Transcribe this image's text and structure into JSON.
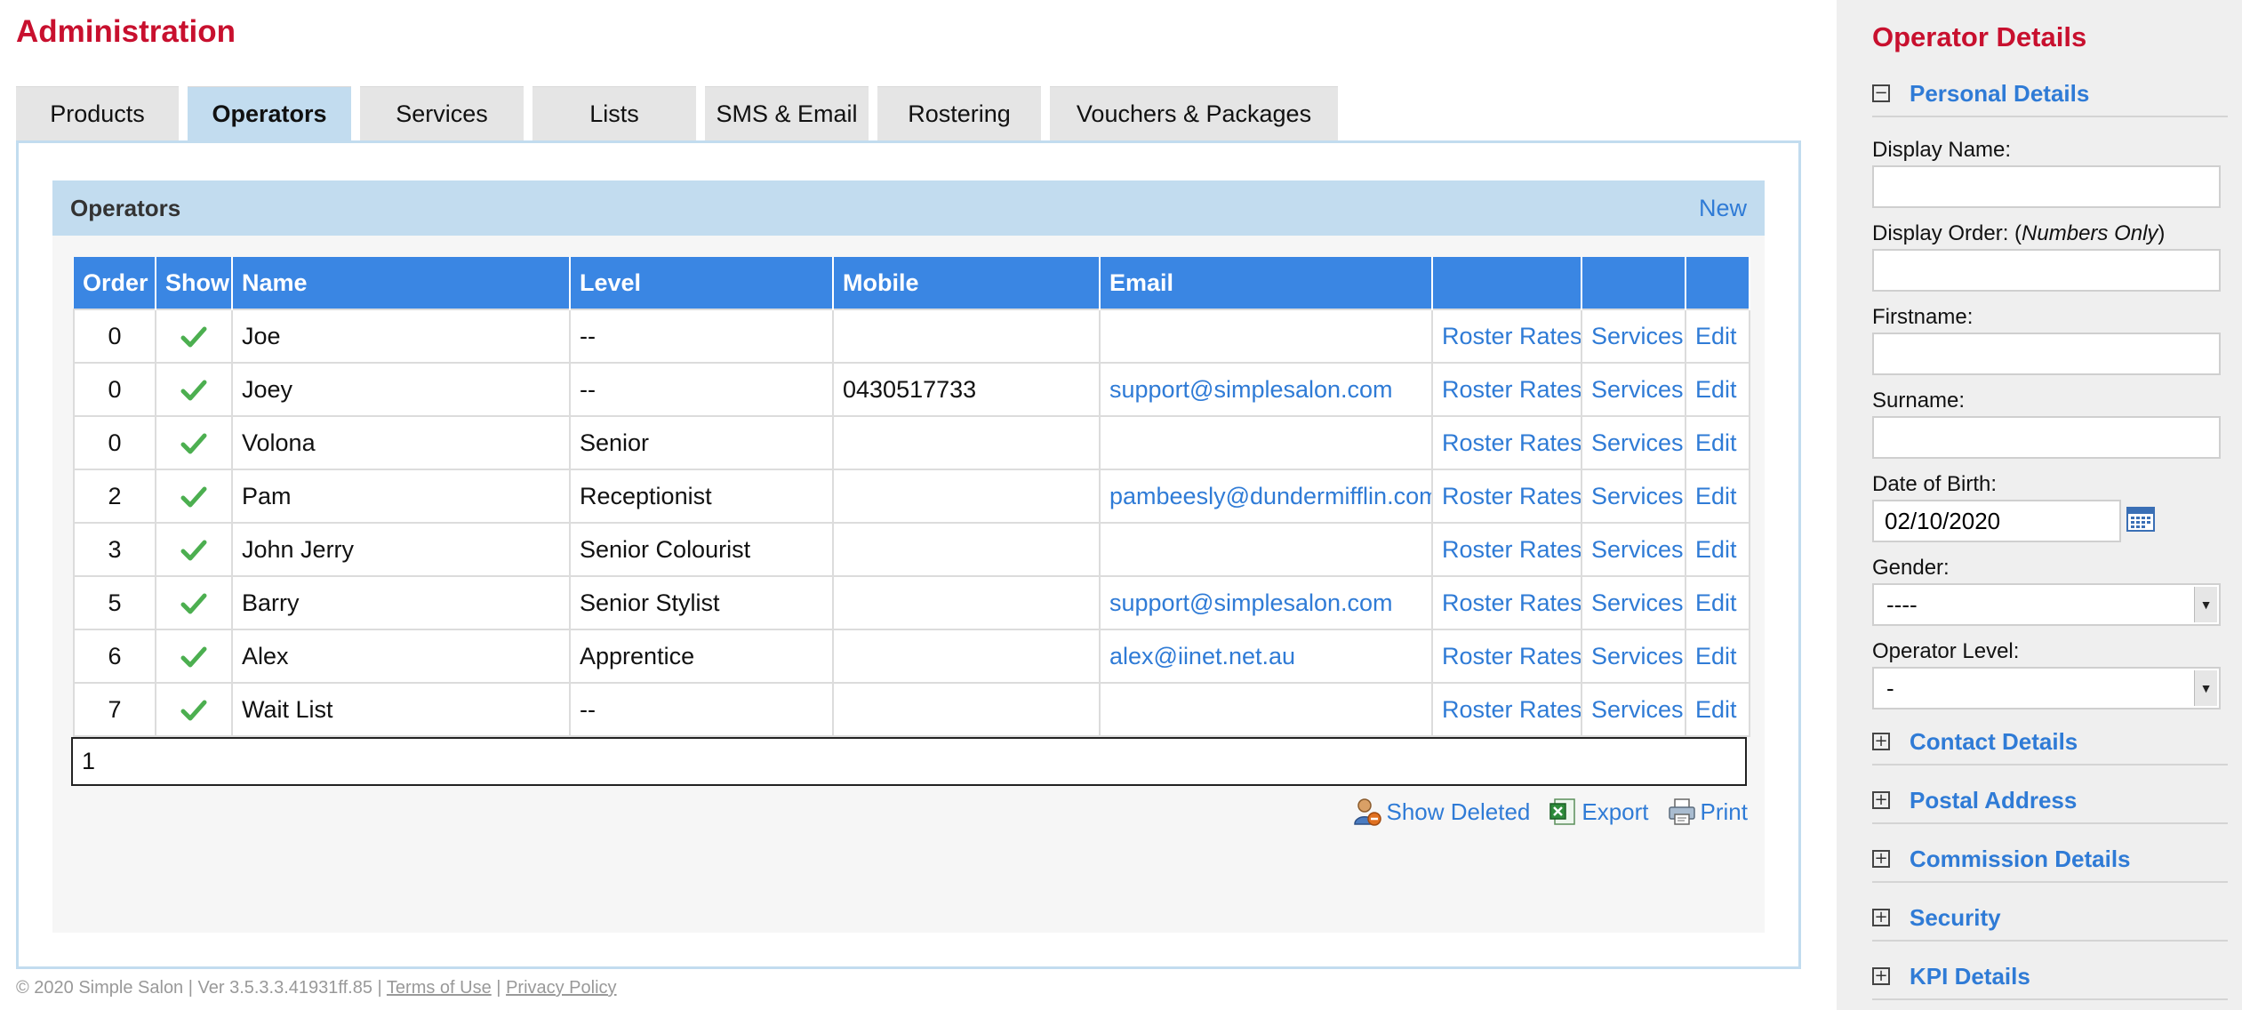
{
  "page": {
    "title": "Administration"
  },
  "tabs": [
    {
      "label": "Products",
      "active": false
    },
    {
      "label": "Operators",
      "active": true
    },
    {
      "label": "Services",
      "active": false
    },
    {
      "label": "Lists",
      "active": false
    },
    {
      "label": "SMS & Email",
      "active": false
    },
    {
      "label": "Rostering",
      "active": false
    },
    {
      "label": "Vouchers & Packages",
      "active": false
    }
  ],
  "operators_panel": {
    "title": "Operators",
    "new_label": "New",
    "columns": [
      "Order",
      "Show",
      "Name",
      "Level",
      "Mobile",
      "Email",
      "",
      "",
      ""
    ],
    "rows": [
      {
        "order": "0",
        "show": true,
        "name": "Joe",
        "level": "--",
        "mobile": "",
        "email": "",
        "roster": "Roster Rates",
        "services": "Services",
        "edit": "Edit"
      },
      {
        "order": "0",
        "show": true,
        "name": "Joey",
        "level": "--",
        "mobile": "0430517733",
        "email": "support@simplesalon.com",
        "roster": "Roster Rates",
        "services": "Services",
        "edit": "Edit"
      },
      {
        "order": "0",
        "show": true,
        "name": "Volona",
        "level": "Senior",
        "mobile": "",
        "email": "",
        "roster": "Roster Rates",
        "services": "Services",
        "edit": "Edit"
      },
      {
        "order": "2",
        "show": true,
        "name": "Pam",
        "level": "Receptionist",
        "mobile": "",
        "email": "pambeesly@dundermifflin.com",
        "roster": "Roster Rates",
        "services": "Services",
        "edit": "Edit"
      },
      {
        "order": "3",
        "show": true,
        "name": "John Jerry",
        "level": "Senior Colourist",
        "mobile": "",
        "email": "",
        "roster": "Roster Rates",
        "services": "Services",
        "edit": "Edit"
      },
      {
        "order": "5",
        "show": true,
        "name": "Barry",
        "level": "Senior Stylist",
        "mobile": "",
        "email": "support@simplesalon.com",
        "roster": "Roster Rates",
        "services": "Services",
        "edit": "Edit"
      },
      {
        "order": "6",
        "show": true,
        "name": "Alex",
        "level": "Apprentice",
        "mobile": "",
        "email": "alex@iinet.net.au",
        "roster": "Roster Rates",
        "services": "Services",
        "edit": "Edit"
      },
      {
        "order": "7",
        "show": true,
        "name": "Wait List",
        "level": "--",
        "mobile": "",
        "email": "",
        "roster": "Roster Rates",
        "services": "Services",
        "edit": "Edit"
      }
    ],
    "pager": "1",
    "actions": {
      "show_deleted": "Show Deleted",
      "export": "Export",
      "print": "Print"
    }
  },
  "footer": {
    "copyright": "© 2020 Simple Salon | Ver 3.5.3.3.41931ff.85 |",
    "terms": "Terms of Use",
    "sep": "|",
    "privacy": "Privacy Policy"
  },
  "sidebar": {
    "title": "Operator Details",
    "personal_section": "Personal Details",
    "fields": {
      "display_name_label": "Display Name:",
      "display_name_value": "",
      "display_order_label": "Display Order: (",
      "display_order_hint": "Numbers Only",
      "display_order_close": ")",
      "display_order_value": "",
      "firstname_label": "Firstname:",
      "firstname_value": "",
      "surname_label": "Surname:",
      "surname_value": "",
      "dob_label": "Date of Birth:",
      "dob_value": "02/10/2020",
      "gender_label": "Gender:",
      "gender_value": "----",
      "level_label": "Operator Level:",
      "level_value": "-"
    },
    "sections": [
      "Contact Details",
      "Postal Address",
      "Commission Details",
      "Security",
      "KPI Details"
    ]
  },
  "colors": {
    "brand_red": "#c8102e",
    "link_blue": "#2f7bd6",
    "header_blue": "#3a86e3",
    "tab_active": "#c2dcef",
    "check_green": "#4caf50"
  }
}
